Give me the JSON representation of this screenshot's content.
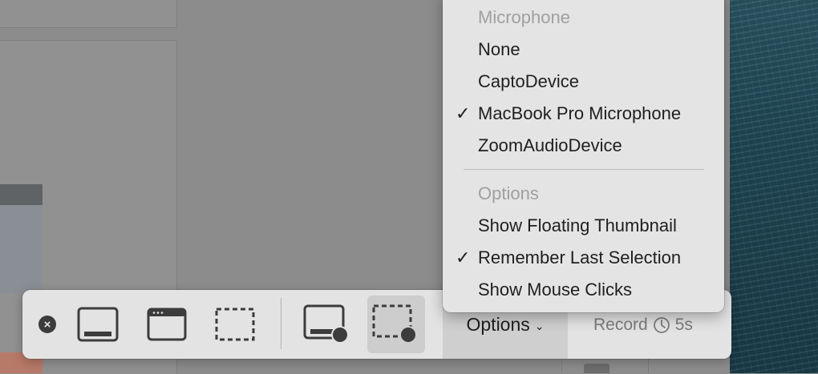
{
  "menu": {
    "sections": [
      {
        "header": "Microphone",
        "items": [
          {
            "label": "None",
            "checked": false
          },
          {
            "label": "CaptoDevice",
            "checked": false
          },
          {
            "label": "MacBook Pro Microphone",
            "checked": true
          },
          {
            "label": "ZoomAudioDevice",
            "checked": false
          }
        ]
      },
      {
        "header": "Options",
        "items": [
          {
            "label": "Show Floating Thumbnail",
            "checked": false
          },
          {
            "label": "Remember Last Selection",
            "checked": true
          },
          {
            "label": "Show Mouse Clicks",
            "checked": false
          }
        ]
      }
    ],
    "check_glyph": "✓"
  },
  "toolbar": {
    "close_icon": "close-icon",
    "tools": [
      {
        "name": "capture-entire-screen",
        "icon": "screen-icon",
        "selected": false
      },
      {
        "name": "capture-selected-window",
        "icon": "window-icon",
        "selected": false
      },
      {
        "name": "capture-selected-portion",
        "icon": "dashed-selection-icon",
        "selected": false
      },
      {
        "name": "record-entire-screen",
        "icon": "screen-record-icon",
        "selected": false
      },
      {
        "name": "record-selected-portion",
        "icon": "selection-record-icon",
        "selected": true
      }
    ],
    "options_label": "Options",
    "options_chevron": "⌄",
    "record_label": "Record",
    "timer_label": "5s"
  },
  "colors": {
    "toolbar_bg": "#e3e3e3",
    "menu_bg": "#e4e4e4",
    "selected_tool_bg": "#cdcdcd",
    "icon_dark": "#3c3c3c",
    "disabled_text": "#a0a0a0"
  }
}
